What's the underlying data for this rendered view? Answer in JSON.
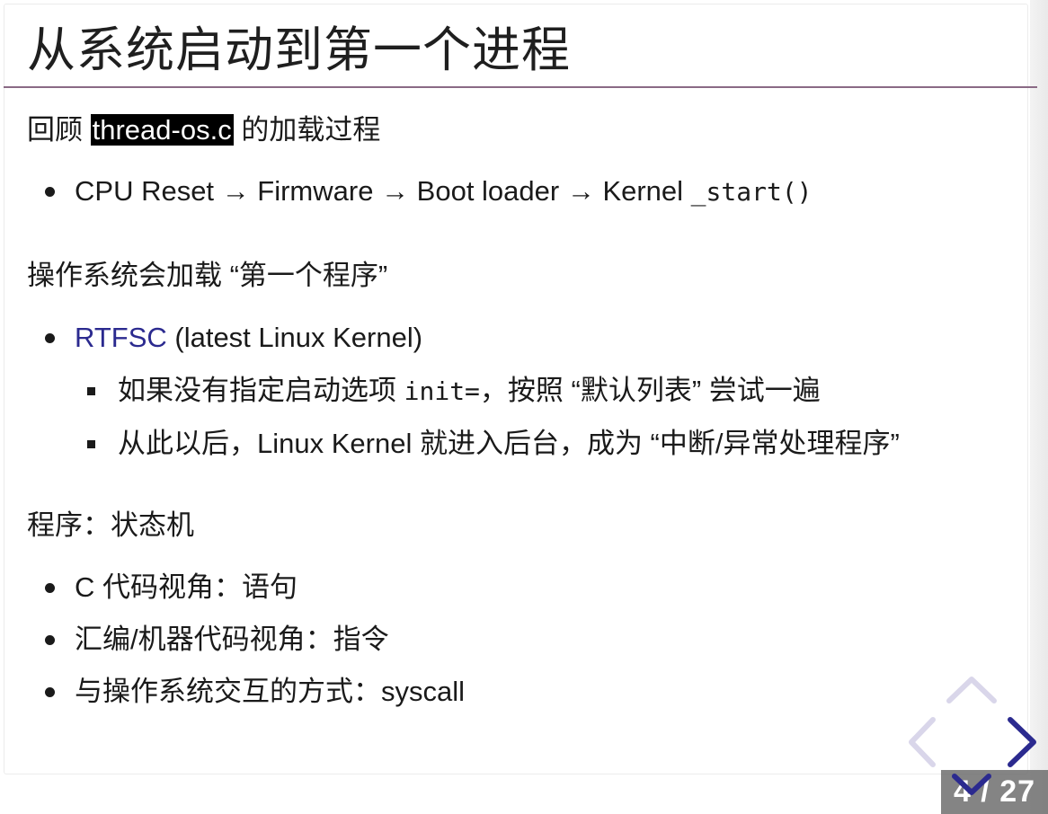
{
  "slide": {
    "title": "从系统启动到第一个进程",
    "section1": {
      "prefix": "回顾 ",
      "highlight": "thread-os.c",
      "suffix": " 的加载过程",
      "bullets": [
        {
          "text": "CPU Reset → Firmware → Boot loader → Kernel ",
          "code": "_start()"
        }
      ]
    },
    "section2": {
      "heading": "操作系统会加载 “第一个程序”",
      "bullet_link": "RTFSC",
      "bullet_rest": " (latest Linux Kernel)",
      "subs": [
        {
          "pre": "如果没有指定启动选项 ",
          "code": "init=",
          "post": "，按照 “默认列表” 尝试一遍"
        },
        {
          "pre": "从此以后，Linux Kernel 就进入后台，成为 “中断/异常处理程序”",
          "code": "",
          "post": ""
        }
      ]
    },
    "section3": {
      "heading": "程序：状态机",
      "bullets": [
        "C 代码视角：语句",
        "汇编/机器代码视角：指令",
        "与操作系统交互的方式：syscall"
      ]
    }
  },
  "nav": {
    "counter": "4 / 27",
    "link_color": "#2b2a8f",
    "rule_color": "#8a6a85"
  }
}
